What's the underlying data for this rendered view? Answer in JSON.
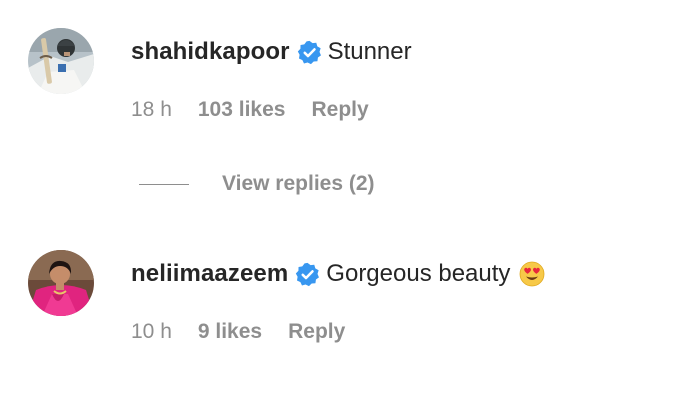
{
  "comments": [
    {
      "username": "shahidkapoor",
      "text": "Stunner",
      "time": "18 h",
      "likes": "103 likes",
      "reply_label": "Reply",
      "avatar": "user-photo-man-with-bat",
      "verified_icon": "verified-badge-icon"
    },
    {
      "username": "neliimaazeem",
      "text": "Gorgeous beauty",
      "emoji": "smiling-face-with-heart-eyes-emoji",
      "time": "10 h",
      "likes": "9 likes",
      "reply_label": "Reply",
      "avatar": "user-photo-woman-in-pink-saree",
      "verified_icon": "verified-badge-icon"
    }
  ],
  "view_replies": {
    "label": "View replies (2)"
  },
  "colors": {
    "primary_text": "#262626",
    "secondary_text": "#8e8e8e",
    "verified_blue": "#3897f0",
    "background": "#ffffff"
  }
}
